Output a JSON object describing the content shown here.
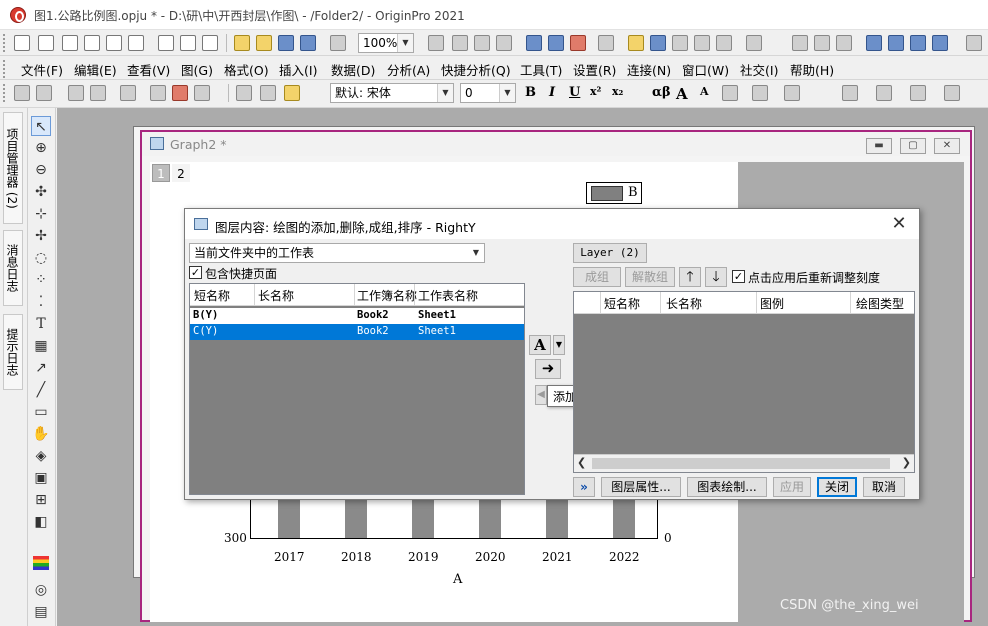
{
  "app": {
    "title": "图1.公路比例图.opju * - D:\\研\\中\\开西封层\\作图\\ - /Folder2/ - OriginPro 2021"
  },
  "toolbar1": {
    "zoom": "100%"
  },
  "menu": {
    "items": [
      "文件(F)",
      "编辑(E)",
      "查看(V)",
      "图(G)",
      "格式(O)",
      "插入(I)",
      "数据(D)",
      "分析(A)",
      "快捷分析(Q)",
      "工具(T)",
      "设置(R)",
      "连接(N)",
      "窗口(W)",
      "社交(I)",
      "帮助(H)"
    ]
  },
  "format_toolbar": {
    "font": "默认: 宋体",
    "font_size": "0",
    "bold": "B",
    "italic": "I",
    "underline": "U",
    "superscript": "x²",
    "subscript": "x₂",
    "greek": "αβ",
    "grow_font": "A",
    "shrink_font": "A"
  },
  "left_panels": {
    "project_manager": "项目管理器 (2)",
    "messages_log": "消息日志",
    "hints_log": "提示日志"
  },
  "graph_window": {
    "title": "Graph2 *",
    "layer_tabs": [
      "1",
      "2"
    ],
    "legend_label": "B",
    "x_ticks": [
      "2017",
      "2018",
      "2019",
      "2020",
      "2021",
      "2022"
    ],
    "x_label": "A",
    "y_left_tick": "300",
    "y_right_tick": "0"
  },
  "dialog": {
    "title": "图层内容: 绘图的添加,删除,成组,排序 - RightY",
    "source_dropdown": "当前文件夹中的工作表",
    "include_shortcut_label": "包含快捷页面",
    "include_shortcut_checked": true,
    "left_columns": [
      "短名称",
      "长名称",
      "工作簿名称",
      "工作表名称"
    ],
    "left_rows": [
      {
        "short": "B(Y)",
        "long": "",
        "book": "Book2",
        "sheet": "Sheet1"
      },
      {
        "short": "C(Y)",
        "long": "",
        "book": "Book2",
        "sheet": "Sheet1"
      }
    ],
    "layer_button": "Layer (2)",
    "group_button": "成组",
    "ungroup_button": "解散组",
    "rescale_label": "点击应用后重新调整刻度",
    "rescale_checked": true,
    "right_columns": [
      "短名称",
      "长名称",
      "图例",
      "绘图类型"
    ],
    "tooltip": "添加绘图",
    "more_button": "»",
    "layer_props_button": "图层属性...",
    "plot_details_button": "图表绘制...",
    "apply_button": "应用",
    "close_button": "关闭",
    "cancel_button": "取消"
  },
  "watermark": "CSDN @the_xing_wei",
  "colors": {
    "graph_border": "#a8267f",
    "selection": "#0078d7",
    "bar": "#8a8a8a"
  }
}
